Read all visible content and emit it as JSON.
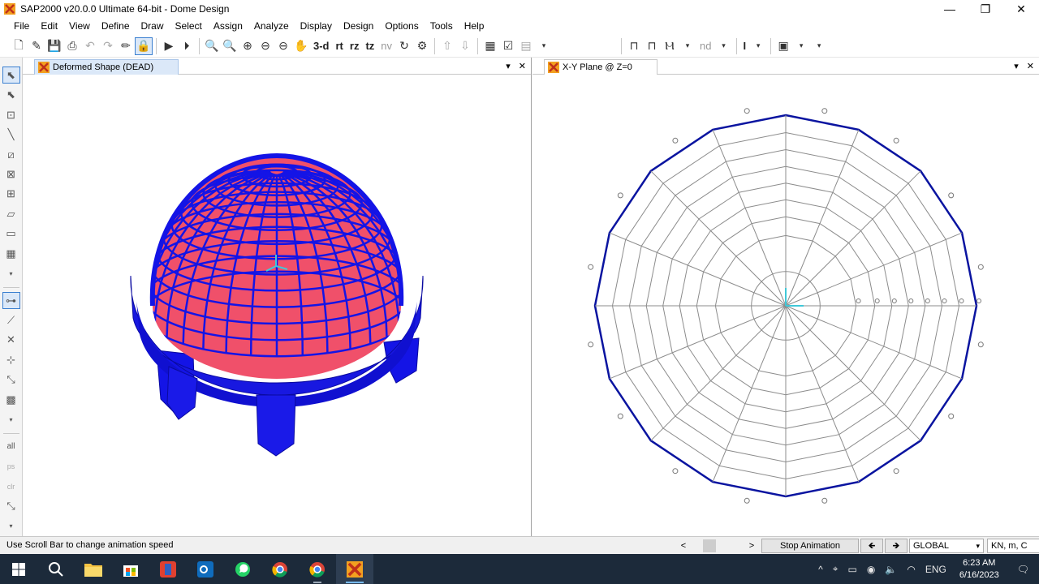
{
  "window": {
    "title": "SAP2000 v20.0.0 Ultimate 64-bit - Dome Design",
    "controls": [
      "—",
      "❐",
      "✕"
    ]
  },
  "menu": [
    "File",
    "Edit",
    "View",
    "Define",
    "Draw",
    "Select",
    "Assign",
    "Analyze",
    "Display",
    "Design",
    "Options",
    "Tools",
    "Help"
  ],
  "toolbar": {
    "view_3d": "3-d",
    "view_rt": "rt",
    "view_rz": "rz",
    "view_tz": "tz",
    "view_nv": "nv",
    "nd": "nd",
    "text_tool": "I"
  },
  "left_pane": {
    "tab_title": "Deformed Shape (DEAD)",
    "ctrl_dropdown": "▾",
    "ctrl_close": "✕"
  },
  "right_pane": {
    "tab_title": "X-Y Plane @ Z=0",
    "ctrl_dropdown": "▾",
    "ctrl_close": "✕",
    "plan": {
      "sides": 16,
      "rings": 8
    }
  },
  "status": {
    "message": "Use Scroll Bar to change animation speed",
    "scroll_left": "<",
    "scroll_right": ">",
    "stop_animation": "Stop Animation",
    "prev": "🡸",
    "next": "🡺",
    "coord_system": "GLOBAL",
    "units": "KN, m, C"
  },
  "taskbar": {
    "tray_up": "^",
    "lang": "ENG",
    "time": "6:23 AM",
    "date": "6/16/2023"
  },
  "colors": {
    "dome_fill": "#f0506a",
    "dome_frame": "#1414e6",
    "plan_outline": "#0a14a0",
    "plan_grid": "#8c8c8c",
    "accent": "#3a7fd0"
  }
}
